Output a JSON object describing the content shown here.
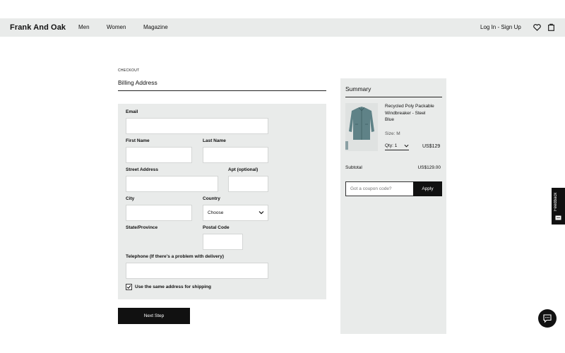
{
  "nav": {
    "brand": "Frank And Oak",
    "links": [
      "Men",
      "Women",
      "Magazine"
    ],
    "login": "Log In - Sign Up"
  },
  "checkout": {
    "crumb": "CHECKOUT",
    "title": "Billing Address"
  },
  "form": {
    "email_label": "Email",
    "first_name_label": "First Name",
    "last_name_label": "Last Name",
    "street_label": "Street Address",
    "apt_label": "Apt (optional)",
    "city_label": "City",
    "country_label": "Country",
    "country_value": "Choose",
    "state_label": "State/Province",
    "postal_label": "Postal Code",
    "phone_label": "Telephone (If there's a problem with delivery)",
    "same_address_label": "Use the same address for shipping",
    "same_address_checked": true
  },
  "next_button": "Next Step",
  "summary": {
    "title": "Summary",
    "product_name": "Recycled Poly Packable Windbreaker - Steel Blue",
    "size": "Size: M",
    "qty": "Qty: 1",
    "price": "US$129",
    "subtotal_label": "Subtotal",
    "subtotal_value": "US$129.00",
    "coupon_placeholder": "Got a coupon code?",
    "apply_label": "Apply"
  },
  "feedback_label": "Feedback",
  "colors": {
    "panel": "#e9ebea",
    "dark": "#111111",
    "product": "#5f8287"
  }
}
